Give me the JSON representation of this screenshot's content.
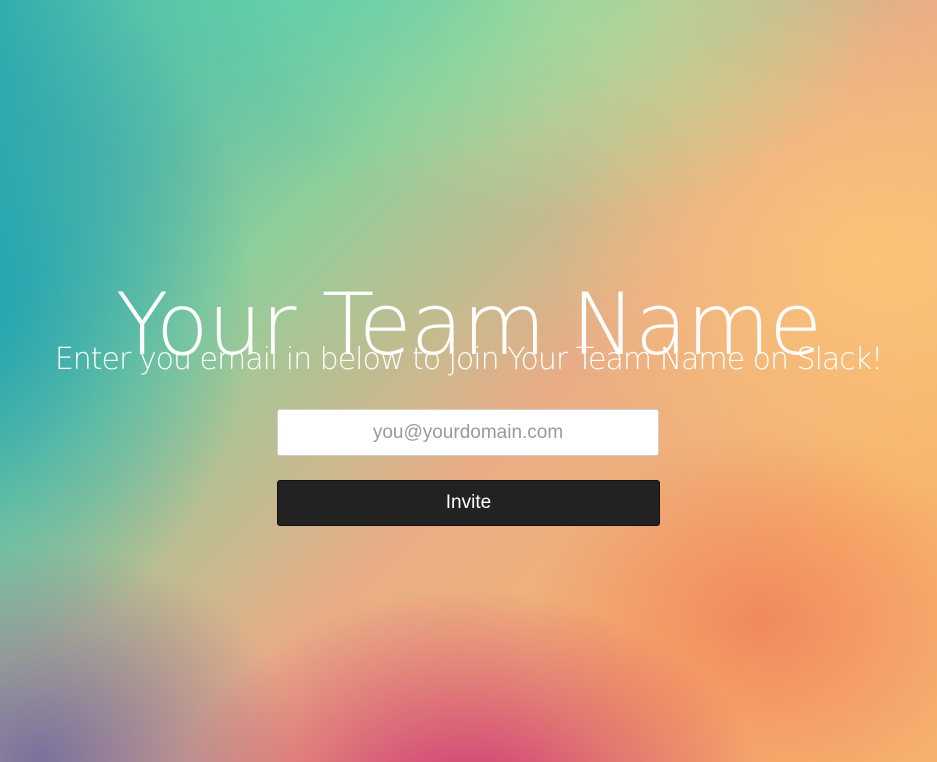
{
  "page": {
    "title": "Your Team Name",
    "subtitle": "Enter you email in below to join Your Team Name on Slack!"
  },
  "form": {
    "email_placeholder": "you@yourdomain.com",
    "email_value": "",
    "invite_label": "Invite"
  },
  "colors": {
    "button_bg": "#222222",
    "button_text": "#ffffff",
    "heading_text": "#ffffff",
    "background_teal": "#2aa6ae",
    "background_green": "#8fcf9b",
    "background_orange": "#f7b36c",
    "background_magenta": "#c8287a"
  }
}
